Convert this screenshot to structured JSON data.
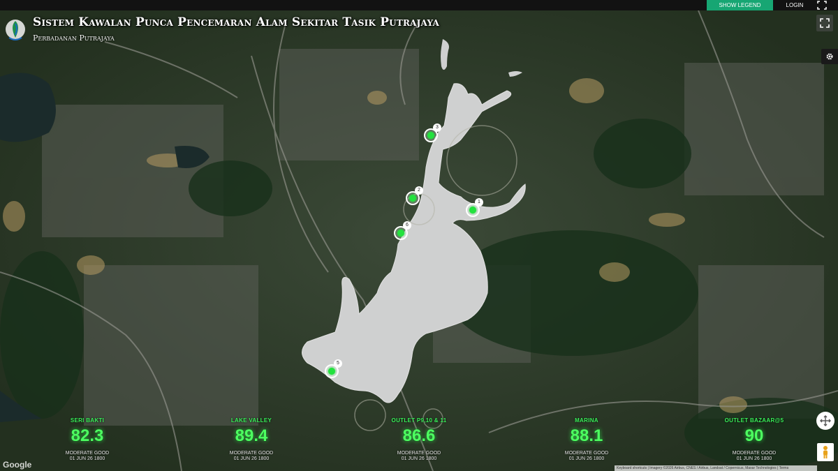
{
  "header": {
    "show_legend_label": "SHOW LEGEND",
    "login_label": "LOGIN"
  },
  "title": "Sistem Kawalan Punca Pencemaran Alam Sekitar Tasik Putrajaya",
  "subtitle": "Perbadanan Putrajaya",
  "markers": [
    {
      "number": "1"
    },
    {
      "number": "2"
    },
    {
      "number": "3"
    },
    {
      "number": "5"
    },
    {
      "number": "6"
    }
  ],
  "stations": [
    {
      "name": "SERI BAKTI",
      "value": "82.3",
      "status": "MODERATE GOOD",
      "time": "01 JUN 26 1800"
    },
    {
      "name": "LAKE VALLEY",
      "value": "89.4",
      "status": "MODERATE GOOD",
      "time": "01 JUN 26 1800"
    },
    {
      "name": "OUTLET P9,10 & 11",
      "value": "86.6",
      "status": "MODERATE GOOD",
      "time": "01 JUN 26 1800"
    },
    {
      "name": "MARINA",
      "value": "88.1",
      "status": "MODERATE GOOD",
      "time": "01 JUN 26 1800"
    },
    {
      "name": "OUTLET BAZAAR@5",
      "value": "90",
      "status": "MODERATE GOOD",
      "time": "01 JUN 26 1800"
    }
  ],
  "map": {
    "google_label": "Google",
    "attribution": "Keyboard shortcuts | Imagery ©2026 Airbus, CNES / Airbus, Landsat / Copernicus, Maxar Technologies | Terms"
  },
  "colors": {
    "accent": "#17a673",
    "station_text": "#4dff60",
    "marker_dot": "#23e23e",
    "lake": "#cfd0d0"
  }
}
